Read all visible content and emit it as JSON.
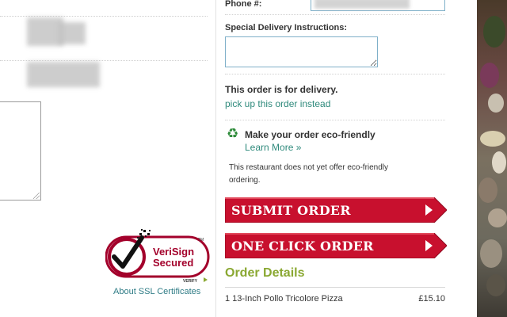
{
  "form": {
    "phone_label": "Phone #:",
    "instructions_label": "Special Delivery Instructions:"
  },
  "delivery": {
    "status_text": "This order is for delivery.",
    "pickup_link": "pick up this order instead"
  },
  "eco": {
    "icon": "recycle-icon",
    "icon_glyph": "♻",
    "title": "Make your order eco-friendly",
    "learn_more": "Learn More »",
    "note": "This restaurant does not yet offer eco-friendly ordering."
  },
  "buttons": {
    "submit": "SUBMIT ORDER",
    "one_click": "ONE CLICK ORDER"
  },
  "security": {
    "badge_name": "VeriSign Secured",
    "badge_line1": "VeriSign",
    "badge_line2": "Secured",
    "badge_verify": "VERIFY",
    "badge_tm": "TM",
    "ssl_link": "About SSL Certificates"
  },
  "order_details": {
    "heading": "Order Details",
    "items": [
      {
        "name": "1 13-Inch Pollo Tricolore Pizza",
        "price": "£15.10"
      }
    ]
  },
  "colors": {
    "button_red": "#c8102e",
    "link_teal": "#2f8a7c",
    "heading_green": "#8aa832",
    "input_border": "#7fb0c9",
    "verisign_red": "#a3002b"
  }
}
